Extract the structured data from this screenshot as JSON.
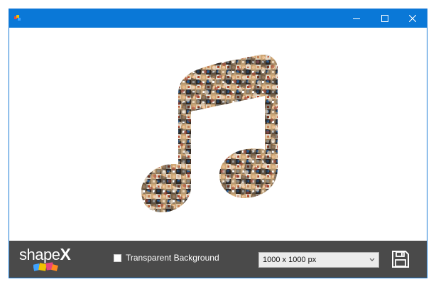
{
  "window": {
    "title": "",
    "title_bar_color": "#0a78d7",
    "bottom_bar_color": "#4a4a4a",
    "controls": [
      "minimize-icon",
      "maximize-icon",
      "close-icon"
    ]
  },
  "canvas": {
    "shape": "music-note",
    "fill": "photo-collage"
  },
  "bottom_bar": {
    "logo": "shapeX",
    "transparent_background": {
      "label": "Transparent Background",
      "checked": false
    },
    "size_select": {
      "value": "1000 x 1000 px"
    },
    "save_icon": "floppy-disk-icon"
  }
}
